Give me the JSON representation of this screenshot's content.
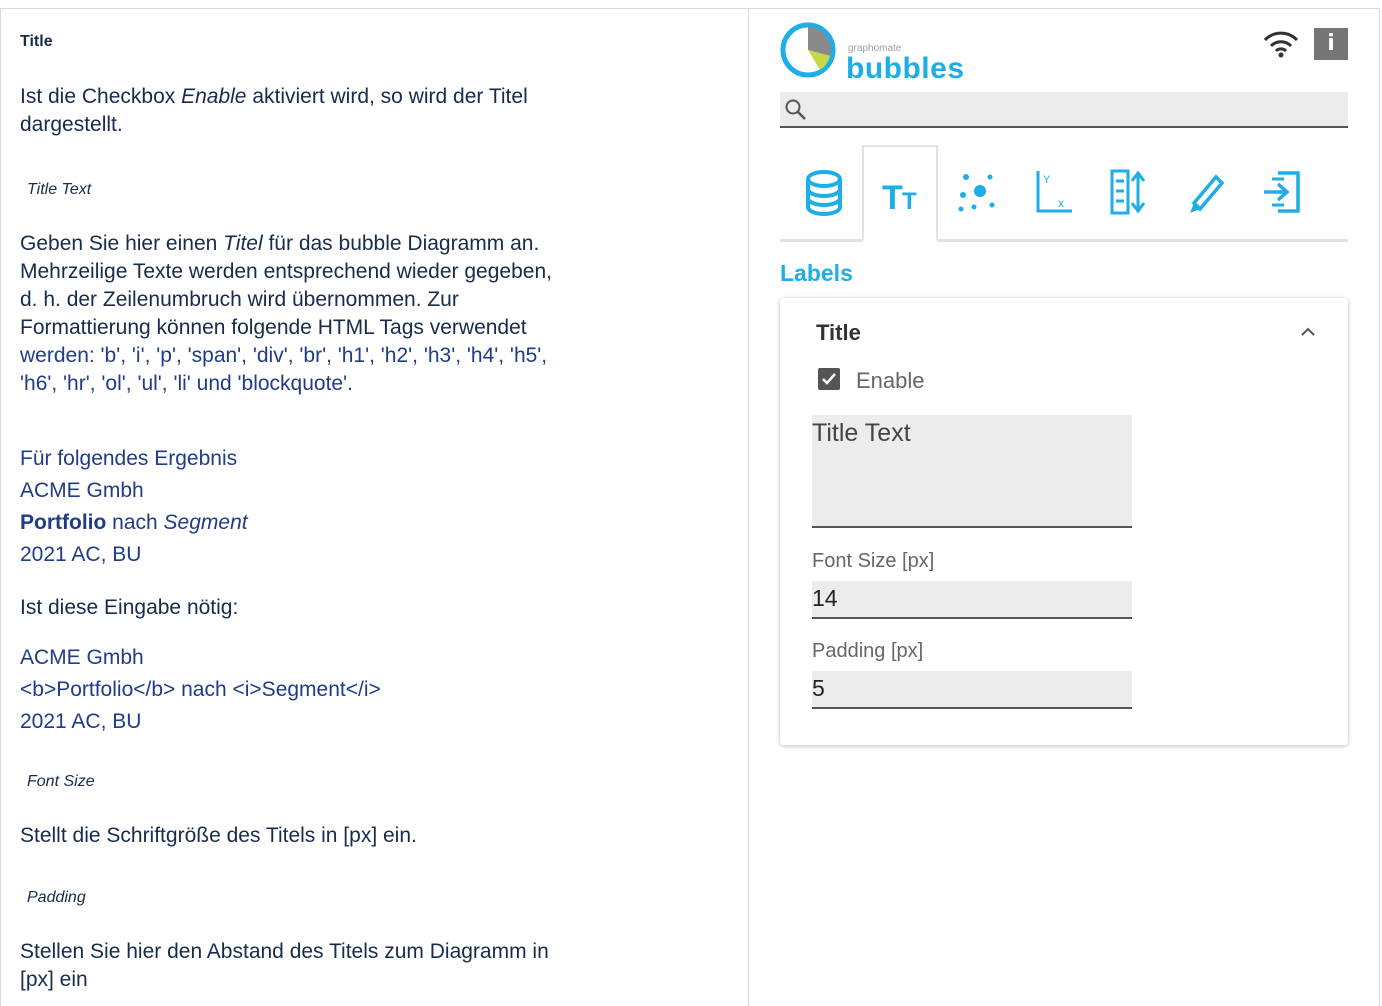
{
  "doc": {
    "heading": "Title",
    "intro_pre": "Ist die Checkbox ",
    "intro_em": "Enable",
    "intro_post": " aktiviert wird, so wird der Titel",
    "intro_line2": "dargestellt.",
    "title_text_heading": "Title Text",
    "tt_line1_pre": "Geben Sie hier einen ",
    "tt_line1_em": "Titel",
    "tt_line1_post": " für das bubble Diagramm an.",
    "tt_line2": "Mehrzeilige Texte werden entsprechend wieder gegeben,",
    "tt_line3": "d. h. der Zeilenumbruch wird übernommen. Zur",
    "tt_line4": "Formattierung können folgende HTML Tags verwendet",
    "tt_line5": "werden: 'b', 'i', 'p', 'span', 'div', 'br', 'h1', 'h2', 'h3', 'h4', 'h5',",
    "tt_line6": "'h6', 'hr', 'ol', 'ul', 'li' und 'blockquote'.",
    "result_line1": "Für folgendes Ergebnis",
    "result_line2": "ACME Gmbh",
    "result_line3_bold": "Portfolio",
    "result_line3_mid": " nach ",
    "result_line3_em": "Segment",
    "result_line4": "2021 AC, BU",
    "input_needed": "Ist diese Eingabe nötig:",
    "code_line1": "ACME Gmbh",
    "code_line2": "<b>Portfolio</b> nach <i>Segment</i>",
    "code_line3": "2021 AC, BU",
    "font_size_heading": "Font Size",
    "font_size_desc": "Stellt die Schriftgröße des Titels in [px] ein.",
    "padding_heading": "Padding",
    "padding_desc_1": " Stellen Sie hier den Abstand des Titels zum Diagramm in",
    "padding_desc_2": "[px] ein"
  },
  "panel": {
    "brand_small": "graphomate",
    "brand_big": "bubbles",
    "info_label": "i",
    "search_placeholder": "",
    "tabs": [
      {
        "icon": "database-icon"
      },
      {
        "icon": "text-format-icon"
      },
      {
        "icon": "bubbles-icon"
      },
      {
        "icon": "axis-icon"
      },
      {
        "icon": "sort-icon"
      },
      {
        "icon": "pencil-icon"
      },
      {
        "icon": "export-icon"
      }
    ],
    "active_tab": 1,
    "section_label": "Labels",
    "card_title": "Title",
    "enable_label": "Enable",
    "enable_checked": true,
    "title_text_value": "Title Text",
    "font_size_label": "Font Size [px]",
    "font_size_value": "14",
    "padding_label": "Padding [px]",
    "padding_value": "5"
  },
  "colors": {
    "accent": "#1eaee7",
    "text": "#172b4d",
    "link_blue": "#1f3c88",
    "icon_gray": "#757575"
  }
}
